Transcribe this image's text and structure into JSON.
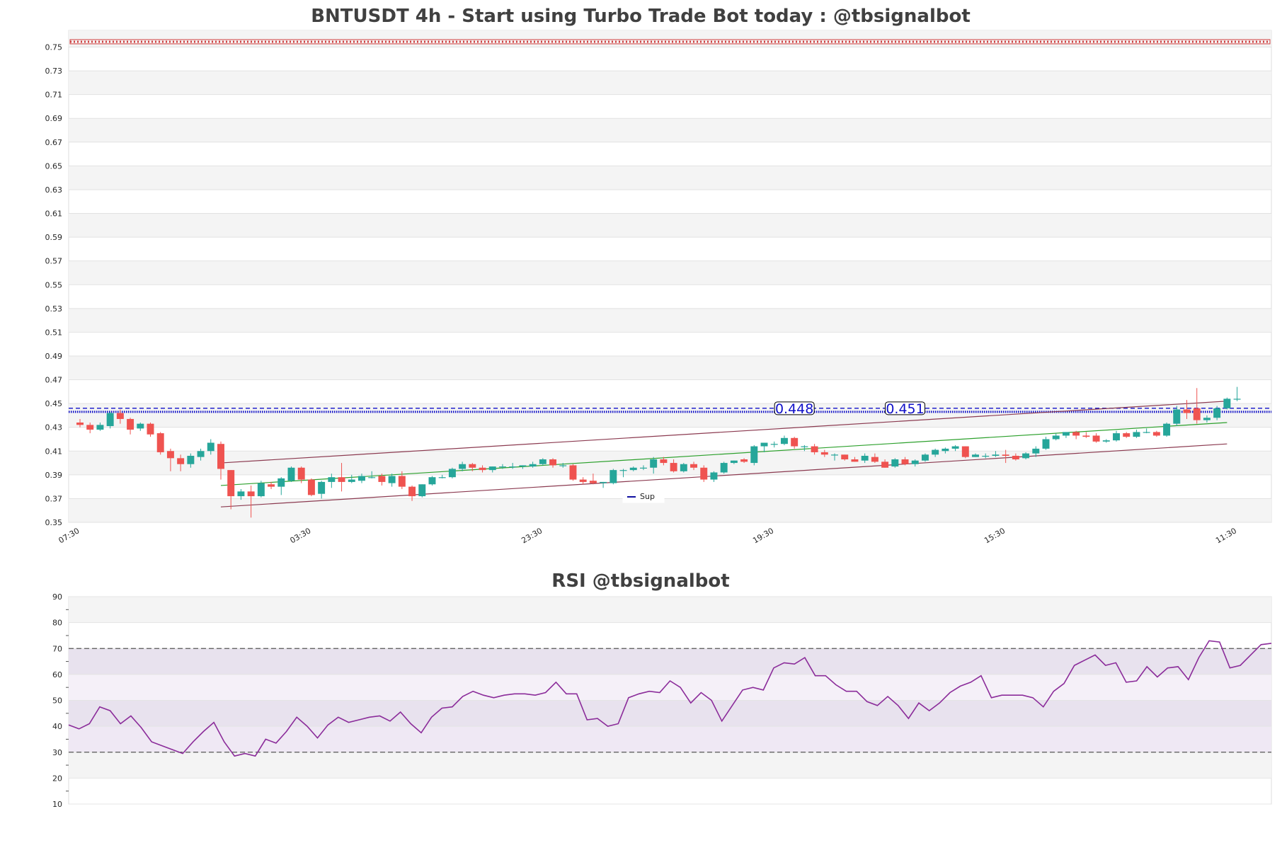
{
  "chart_data": [
    {
      "type": "candlestick",
      "title": "BNTUSDT 4h - Start using Turbo Trade Bot today : @tbsignalbot",
      "ylim": [
        0.35,
        0.764
      ],
      "yticks": [
        0.35,
        0.37,
        0.39,
        0.41,
        0.43,
        0.45,
        0.47,
        0.49,
        0.51,
        0.53,
        0.55,
        0.57,
        0.59,
        0.61,
        0.63,
        0.65,
        0.67,
        0.69,
        0.71,
        0.73,
        0.75
      ],
      "ytick_labels": [
        "0.35",
        "0.37",
        "0.39",
        "0.41",
        "0.43",
        "0.45",
        "0.47",
        "0.49",
        "0.51",
        "0.53",
        "0.55",
        "0.57",
        "0.59",
        "0.61",
        "0.63",
        "0.65",
        "0.67",
        "0.69",
        "0.71",
        "0.73",
        "0.75"
      ],
      "xtick_labels": [
        "07:30",
        "03:30",
        "23:30",
        "19:30",
        "15:30",
        "11:30"
      ],
      "xtick_index": [
        0,
        23,
        46,
        69,
        92,
        115
      ],
      "candle_count": 118,
      "candles": [
        [
          0.434,
          0.437,
          0.43,
          0.432
        ],
        [
          0.432,
          0.434,
          0.425,
          0.428
        ],
        [
          0.428,
          0.434,
          0.427,
          0.432
        ],
        [
          0.431,
          0.443,
          0.429,
          0.442
        ],
        [
          0.442,
          0.445,
          0.433,
          0.437
        ],
        [
          0.437,
          0.438,
          0.424,
          0.428
        ],
        [
          0.429,
          0.434,
          0.427,
          0.433
        ],
        [
          0.433,
          0.434,
          0.422,
          0.424
        ],
        [
          0.425,
          0.426,
          0.407,
          0.409
        ],
        [
          0.41,
          0.412,
          0.393,
          0.404
        ],
        [
          0.404,
          0.407,
          0.393,
          0.399
        ],
        [
          0.399,
          0.408,
          0.396,
          0.406
        ],
        [
          0.405,
          0.412,
          0.402,
          0.41
        ],
        [
          0.41,
          0.42,
          0.407,
          0.417
        ],
        [
          0.416,
          0.418,
          0.386,
          0.395
        ],
        [
          0.394,
          0.394,
          0.361,
          0.372
        ],
        [
          0.372,
          0.378,
          0.369,
          0.376
        ],
        [
          0.376,
          0.381,
          0.354,
          0.372
        ],
        [
          0.372,
          0.385,
          0.371,
          0.383
        ],
        [
          0.382,
          0.384,
          0.378,
          0.38
        ],
        [
          0.38,
          0.388,
          0.373,
          0.387
        ],
        [
          0.385,
          0.397,
          0.384,
          0.396
        ],
        [
          0.396,
          0.397,
          0.383,
          0.386
        ],
        [
          0.386,
          0.387,
          0.372,
          0.373
        ],
        [
          0.374,
          0.385,
          0.37,
          0.384
        ],
        [
          0.384,
          0.391,
          0.379,
          0.388
        ],
        [
          0.388,
          0.4,
          0.376,
          0.384
        ],
        [
          0.384,
          0.39,
          0.383,
          0.386
        ],
        [
          0.385,
          0.391,
          0.383,
          0.389
        ],
        [
          0.388,
          0.393,
          0.387,
          0.388
        ],
        [
          0.389,
          0.391,
          0.381,
          0.384
        ],
        [
          0.383,
          0.391,
          0.38,
          0.389
        ],
        [
          0.389,
          0.393,
          0.378,
          0.38
        ],
        [
          0.38,
          0.381,
          0.368,
          0.372
        ],
        [
          0.372,
          0.382,
          0.371,
          0.382
        ],
        [
          0.382,
          0.389,
          0.381,
          0.388
        ],
        [
          0.388,
          0.39,
          0.387,
          0.388
        ],
        [
          0.388,
          0.396,
          0.387,
          0.395
        ],
        [
          0.395,
          0.401,
          0.393,
          0.399
        ],
        [
          0.399,
          0.4,
          0.393,
          0.396
        ],
        [
          0.396,
          0.398,
          0.392,
          0.394
        ],
        [
          0.394,
          0.397,
          0.392,
          0.397
        ],
        [
          0.397,
          0.399,
          0.395,
          0.397
        ],
        [
          0.397,
          0.4,
          0.395,
          0.397
        ],
        [
          0.397,
          0.398,
          0.395,
          0.398
        ],
        [
          0.397,
          0.401,
          0.396,
          0.399
        ],
        [
          0.399,
          0.404,
          0.398,
          0.403
        ],
        [
          0.403,
          0.404,
          0.396,
          0.398
        ],
        [
          0.398,
          0.4,
          0.396,
          0.398
        ],
        [
          0.398,
          0.399,
          0.385,
          0.386
        ],
        [
          0.386,
          0.388,
          0.382,
          0.384
        ],
        [
          0.385,
          0.391,
          0.382,
          0.383
        ],
        [
          0.383,
          0.384,
          0.379,
          0.384
        ],
        [
          0.383,
          0.395,
          0.382,
          0.394
        ],
        [
          0.394,
          0.395,
          0.388,
          0.394
        ],
        [
          0.394,
          0.397,
          0.393,
          0.396
        ],
        [
          0.396,
          0.398,
          0.394,
          0.396
        ],
        [
          0.396,
          0.405,
          0.391,
          0.403
        ],
        [
          0.403,
          0.405,
          0.398,
          0.4
        ],
        [
          0.4,
          0.403,
          0.392,
          0.393
        ],
        [
          0.393,
          0.4,
          0.392,
          0.399
        ],
        [
          0.399,
          0.401,
          0.394,
          0.396
        ],
        [
          0.396,
          0.398,
          0.384,
          0.386
        ],
        [
          0.386,
          0.393,
          0.384,
          0.392
        ],
        [
          0.392,
          0.401,
          0.391,
          0.4
        ],
        [
          0.4,
          0.402,
          0.399,
          0.402
        ],
        [
          0.403,
          0.404,
          0.4,
          0.401
        ],
        [
          0.4,
          0.415,
          0.398,
          0.414
        ],
        [
          0.414,
          0.417,
          0.409,
          0.417
        ],
        [
          0.416,
          0.418,
          0.413,
          0.416
        ],
        [
          0.416,
          0.423,
          0.415,
          0.421
        ],
        [
          0.421,
          0.422,
          0.412,
          0.414
        ],
        [
          0.414,
          0.415,
          0.41,
          0.414
        ],
        [
          0.414,
          0.416,
          0.407,
          0.409
        ],
        [
          0.409,
          0.411,
          0.405,
          0.407
        ],
        [
          0.407,
          0.408,
          0.402,
          0.407
        ],
        [
          0.407,
          0.407,
          0.402,
          0.403
        ],
        [
          0.403,
          0.405,
          0.401,
          0.401
        ],
        [
          0.402,
          0.408,
          0.4,
          0.406
        ],
        [
          0.405,
          0.408,
          0.4,
          0.401
        ],
        [
          0.401,
          0.403,
          0.396,
          0.396
        ],
        [
          0.397,
          0.404,
          0.396,
          0.403
        ],
        [
          0.403,
          0.405,
          0.398,
          0.399
        ],
        [
          0.399,
          0.403,
          0.397,
          0.402
        ],
        [
          0.402,
          0.408,
          0.401,
          0.407
        ],
        [
          0.407,
          0.412,
          0.405,
          0.411
        ],
        [
          0.41,
          0.413,
          0.408,
          0.412
        ],
        [
          0.412,
          0.415,
          0.41,
          0.414
        ],
        [
          0.414,
          0.414,
          0.404,
          0.405
        ],
        [
          0.405,
          0.408,
          0.405,
          0.407
        ],
        [
          0.406,
          0.408,
          0.404,
          0.406
        ],
        [
          0.406,
          0.41,
          0.405,
          0.407
        ],
        [
          0.407,
          0.411,
          0.4,
          0.406
        ],
        [
          0.406,
          0.408,
          0.402,
          0.403
        ],
        [
          0.404,
          0.409,
          0.403,
          0.408
        ],
        [
          0.408,
          0.414,
          0.405,
          0.412
        ],
        [
          0.412,
          0.422,
          0.411,
          0.42
        ],
        [
          0.42,
          0.425,
          0.419,
          0.423
        ],
        [
          0.423,
          0.426,
          0.421,
          0.426
        ],
        [
          0.426,
          0.427,
          0.42,
          0.423
        ],
        [
          0.423,
          0.426,
          0.421,
          0.422
        ],
        [
          0.423,
          0.425,
          0.417,
          0.418
        ],
        [
          0.418,
          0.42,
          0.417,
          0.419
        ],
        [
          0.419,
          0.427,
          0.418,
          0.425
        ],
        [
          0.425,
          0.426,
          0.421,
          0.422
        ],
        [
          0.422,
          0.428,
          0.421,
          0.426
        ],
        [
          0.426,
          0.429,
          0.425,
          0.426
        ],
        [
          0.426,
          0.427,
          0.422,
          0.423
        ],
        [
          0.423,
          0.434,
          0.422,
          0.433
        ],
        [
          0.433,
          0.448,
          0.431,
          0.445
        ],
        [
          0.445,
          0.453,
          0.437,
          0.442
        ],
        [
          0.446,
          0.463,
          0.433,
          0.436
        ],
        [
          0.436,
          0.44,
          0.434,
          0.438
        ],
        [
          0.438,
          0.448,
          0.436,
          0.446
        ],
        [
          0.446,
          0.455,
          0.445,
          0.454
        ],
        [
          0.454,
          0.464,
          0.452,
          0.454
        ]
      ],
      "lines": {
        "resistance_upper": [
          [
            14,
            0.4
          ],
          [
            114,
            0.452
          ]
        ],
        "middle": [
          [
            14,
            0.381
          ],
          [
            114,
            0.434
          ]
        ],
        "support_lower": [
          [
            14,
            0.363
          ],
          [
            114,
            0.416
          ]
        ],
        "upper_red_band": 0.7545
      },
      "horizontal_lines": {
        "blue_dashed": 0.446,
        "blue_dotted": 0.443
      },
      "annotations": [
        {
          "label": "0.448",
          "index": 71
        },
        {
          "label": "0.451",
          "index": 82
        }
      ],
      "legend": [
        {
          "name": "Sup",
          "color": "#1010a0"
        }
      ],
      "legend_placement": "bottom-center",
      "colors": {
        "up": "#26a69a",
        "down": "#ef5350",
        "band_red": "#d04040",
        "grid_band": "#f4f4f4",
        "trend": "#8b3a50",
        "middle_line": "#2ca02c",
        "blue_lines": "#1010c8"
      }
    },
    {
      "type": "line",
      "title": "RSI @tbsignalbot",
      "ylim": [
        10,
        90
      ],
      "yticks": [
        10,
        20,
        30,
        40,
        50,
        60,
        70,
        80,
        90
      ],
      "ytick_labels": [
        "10",
        "20",
        "30",
        "40",
        "50",
        "60",
        "70",
        "80",
        "90"
      ],
      "reference_lines": [
        30,
        70
      ],
      "series": [
        {
          "color": "#8b2c9a",
          "values": [
            40.5,
            39.0,
            41.0,
            47.5,
            46.0,
            41.0,
            44.0,
            39.5,
            34.0,
            32.5,
            31.0,
            29.5,
            34.0,
            38.0,
            41.5,
            34.0,
            28.5,
            29.5,
            28.5,
            35.0,
            33.5,
            38.0,
            43.5,
            40.0,
            35.5,
            40.5,
            43.5,
            41.5,
            42.5,
            43.5,
            44.0,
            42.0,
            45.5,
            41.0,
            37.5,
            43.5,
            47.0,
            47.5,
            51.5,
            53.5,
            52.0,
            51.0,
            52.0,
            52.5,
            52.5,
            52.0,
            53.0,
            57.0,
            52.5,
            52.5,
            42.5,
            43.0,
            40.0,
            41.0,
            51.0,
            52.5,
            53.5,
            53.0,
            57.5,
            55.0,
            49.0,
            53.0,
            50.0,
            42.0,
            48.0,
            54.0,
            55.0,
            54.0,
            62.5,
            64.5,
            64.0,
            66.5,
            59.5,
            59.5,
            56.0,
            53.5,
            53.5,
            49.5,
            48.0,
            51.5,
            48.0,
            43.0,
            49.0,
            46.0,
            49.0,
            53.0,
            55.5,
            57.0,
            59.5,
            51.0,
            52.0,
            52.0,
            52.0,
            51.0,
            47.5,
            53.5,
            56.5,
            63.5,
            65.5,
            67.5,
            63.5,
            64.5,
            57.0,
            57.5,
            63.0,
            59.0,
            62.5,
            63.0,
            58.0,
            66.5,
            73.0,
            72.5,
            62.5,
            63.5,
            67.5,
            71.5,
            72.0
          ]
        }
      ],
      "colors": {
        "grid_band": "#f4f4f4",
        "purple_band": "#efe8f4"
      }
    }
  ]
}
